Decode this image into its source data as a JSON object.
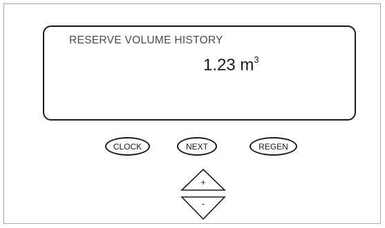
{
  "display": {
    "title": "RESERVE VOLUME HISTORY",
    "value": "1.23 m",
    "unit_superscript": "3"
  },
  "buttons": {
    "clock": "CLOCK",
    "next": "NEXT",
    "regen": "REGEN"
  },
  "arrows": {
    "up": "+",
    "down": "-"
  }
}
